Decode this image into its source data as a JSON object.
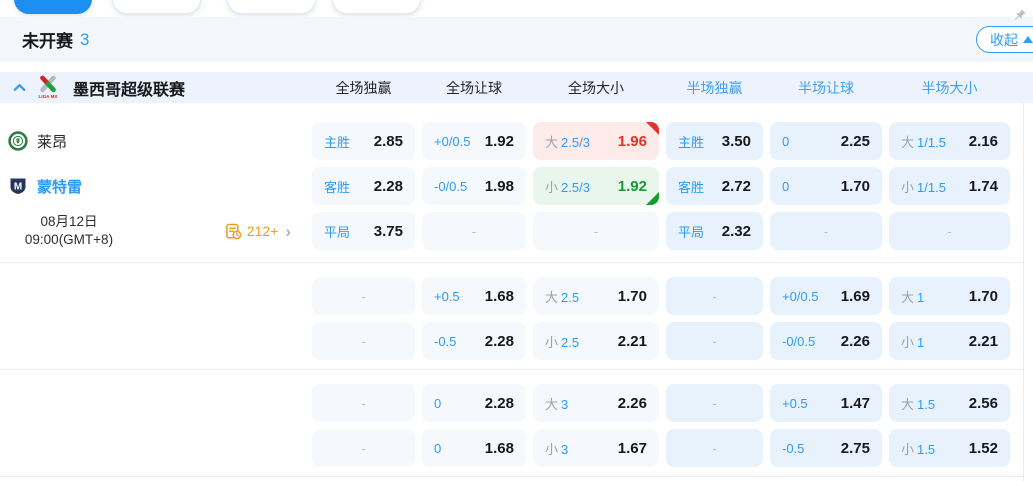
{
  "colors": {
    "accent": "#2e9bf5",
    "up_red": "#e5312b",
    "down_green": "#169b30",
    "full_cell_bg": "#f5f8fc",
    "half_cell_bg": "#e8f2fd",
    "band_bg": "#f3f7fc",
    "header_bg": "#ecf3fc",
    "tab_selected_bg": "#1d8ff2",
    "markets_orange": "#f59a23"
  },
  "top_tabs": {
    "count": 4,
    "selected_index": 0
  },
  "section": {
    "title": "未开赛",
    "count": "3",
    "collapse_label": "收起"
  },
  "icons": {
    "chevron_up": "chevron-up-icon",
    "league_logo": "liga-mx-logo",
    "home_logo": "leon-crest-icon",
    "away_logo": "monterrey-crest-icon",
    "markets": "markets-list-clock-icon",
    "chevron_right": "chevron-right-icon",
    "pin": "pin-icon",
    "collapse_arrow": "collapse-arrow-icon"
  },
  "league": {
    "name": "墨西哥超级联赛",
    "columns": [
      {
        "label": "全场独赢",
        "scope": "full"
      },
      {
        "label": "全场让球",
        "scope": "full"
      },
      {
        "label": "全场大小",
        "scope": "full"
      },
      {
        "label": "半场独赢",
        "scope": "half"
      },
      {
        "label": "半场让球",
        "scope": "half"
      },
      {
        "label": "半场大小",
        "scope": "half"
      }
    ]
  },
  "match": {
    "home": {
      "name": "莱昂"
    },
    "away": {
      "name": "蒙特雷"
    },
    "date": "08月12日",
    "time": "09:00(GMT+8)",
    "markets_count": "212+"
  },
  "odds_groups": [
    {
      "rows": [
        {
          "info": "home",
          "cells": [
            {
              "l": "主胜",
              "v": "2.85",
              "t": "full"
            },
            {
              "l": "+0/0.5",
              "v": "1.92",
              "t": "full"
            },
            {
              "p": "大",
              "l": "2.5/3",
              "v": "1.96",
              "t": "up"
            },
            {
              "l": "主胜",
              "v": "3.50",
              "t": "half"
            },
            {
              "l": "0",
              "v": "2.25",
              "t": "half"
            },
            {
              "p": "大",
              "l": "1/1.5",
              "v": "2.16",
              "t": "half"
            }
          ]
        },
        {
          "info": "away",
          "cells": [
            {
              "l": "客胜",
              "v": "2.28",
              "t": "full"
            },
            {
              "l": "-0/0.5",
              "v": "1.98",
              "t": "full"
            },
            {
              "p": "小",
              "l": "2.5/3",
              "v": "1.92",
              "t": "down"
            },
            {
              "l": "客胜",
              "v": "2.72",
              "t": "half"
            },
            {
              "l": "0",
              "v": "1.70",
              "t": "half"
            },
            {
              "p": "小",
              "l": "1/1.5",
              "v": "1.74",
              "t": "half"
            }
          ]
        },
        {
          "info": "datetime",
          "cells": [
            {
              "l": "平局",
              "v": "3.75",
              "t": "full"
            },
            {
              "dash": true,
              "t": "full"
            },
            {
              "dash": true,
              "t": "full"
            },
            {
              "l": "平局",
              "v": "2.32",
              "t": "half"
            },
            {
              "dash": true,
              "t": "half"
            },
            {
              "dash": true,
              "t": "half"
            }
          ]
        }
      ]
    },
    {
      "rows": [
        {
          "info": null,
          "cells": [
            {
              "dash": true,
              "t": "full"
            },
            {
              "l": "+0.5",
              "v": "1.68",
              "t": "full"
            },
            {
              "p": "大",
              "l": "2.5",
              "v": "1.70",
              "t": "full"
            },
            {
              "dash": true,
              "t": "half"
            },
            {
              "l": "+0/0.5",
              "v": "1.69",
              "t": "half"
            },
            {
              "p": "大",
              "l": "1",
              "v": "1.70",
              "t": "half"
            }
          ]
        },
        {
          "info": null,
          "cells": [
            {
              "dash": true,
              "t": "full"
            },
            {
              "l": "-0.5",
              "v": "2.28",
              "t": "full"
            },
            {
              "p": "小",
              "l": "2.5",
              "v": "2.21",
              "t": "full"
            },
            {
              "dash": true,
              "t": "half"
            },
            {
              "l": "-0/0.5",
              "v": "2.26",
              "t": "half"
            },
            {
              "p": "小",
              "l": "1",
              "v": "2.21",
              "t": "half"
            }
          ]
        }
      ]
    },
    {
      "rows": [
        {
          "info": null,
          "cells": [
            {
              "dash": true,
              "t": "full"
            },
            {
              "l": "0",
              "v": "2.28",
              "t": "full"
            },
            {
              "p": "大",
              "l": "3",
              "v": "2.26",
              "t": "full"
            },
            {
              "dash": true,
              "t": "half"
            },
            {
              "l": "+0.5",
              "v": "1.47",
              "t": "half"
            },
            {
              "p": "大",
              "l": "1.5",
              "v": "2.56",
              "t": "half"
            }
          ]
        },
        {
          "info": null,
          "cells": [
            {
              "dash": true,
              "t": "full"
            },
            {
              "l": "0",
              "v": "1.68",
              "t": "full"
            },
            {
              "p": "小",
              "l": "3",
              "v": "1.67",
              "t": "full"
            },
            {
              "dash": true,
              "t": "half"
            },
            {
              "l": "-0.5",
              "v": "2.75",
              "t": "half"
            },
            {
              "p": "小",
              "l": "1.5",
              "v": "1.52",
              "t": "half"
            }
          ]
        }
      ]
    }
  ]
}
